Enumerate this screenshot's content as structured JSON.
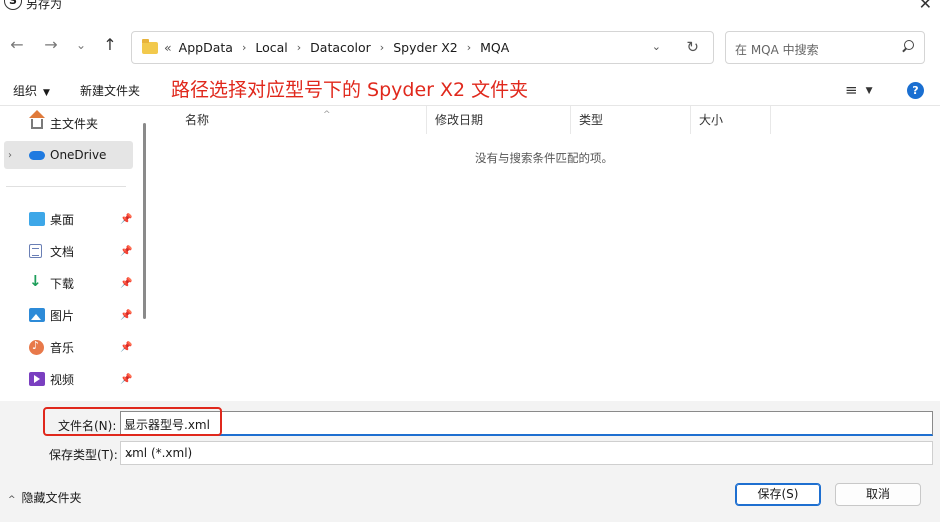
{
  "window": {
    "title": "另存为",
    "app_icon_letter": "S",
    "close_glyph": "✕"
  },
  "nav": {
    "back": "←",
    "forward": "→",
    "recent": "⌄",
    "up": "↑",
    "breadcrumb_prefix": "«",
    "breadcrumbs": [
      "AppData",
      "Local",
      "Datacolor",
      "Spyder X2",
      "MQA"
    ],
    "separator": "›",
    "dropdown": "⌄",
    "refresh": "↻"
  },
  "search": {
    "placeholder": "在 MQA 中搜索"
  },
  "toolbar": {
    "organize": "组织",
    "organize_caret": "▼",
    "new_folder": "新建文件夹",
    "view_icon": "≡",
    "view_caret": "▼",
    "help": "?"
  },
  "annotation": {
    "text": "路径选择对应型号下的 Spyder X2 文件夹",
    "color": "#e0281c"
  },
  "sidebar": {
    "items": [
      {
        "label": "主文件夹",
        "icon": "home-icon"
      },
      {
        "label": "OneDrive",
        "icon": "cloud-icon",
        "chevron": "›"
      },
      {
        "label": "桌面",
        "icon": "desktop-icon",
        "pin": "📌"
      },
      {
        "label": "文档",
        "icon": "document-icon",
        "pin": "📌"
      },
      {
        "label": "下载",
        "icon": "download-icon",
        "glyph": "↓",
        "pin": "📌"
      },
      {
        "label": "图片",
        "icon": "pictures-icon",
        "pin": "📌"
      },
      {
        "label": "音乐",
        "icon": "music-icon",
        "pin": "📌"
      },
      {
        "label": "视频",
        "icon": "video-icon",
        "pin": "📌"
      }
    ]
  },
  "filelist": {
    "columns": [
      "名称",
      "修改日期",
      "类型",
      "大小"
    ],
    "sort_arrow": "^",
    "empty_message": "没有与搜索条件匹配的项。"
  },
  "form": {
    "filename_label": "文件名(N):",
    "filename_value": "显示器型号.xml",
    "filetype_label": "保存类型(T):",
    "filetype_value": "xml (*.xml)",
    "caret": "⌄"
  },
  "footer": {
    "hide_folders_chevron": "^",
    "hide_folders": "隐藏文件夹",
    "save": "保存(S)",
    "cancel": "取消"
  },
  "colors": {
    "accent": "#1e6fd0",
    "annotation": "#e0281c"
  }
}
